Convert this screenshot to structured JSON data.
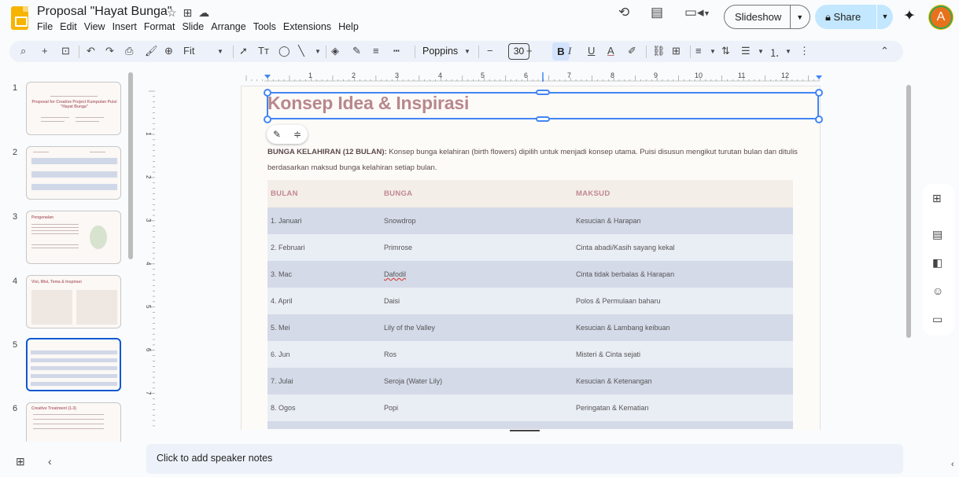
{
  "doc": {
    "title": "Proposal \"Hayat Bunga\""
  },
  "menu": [
    "File",
    "Edit",
    "View",
    "Insert",
    "Format",
    "Slide",
    "Arrange",
    "Tools",
    "Extensions",
    "Help"
  ],
  "header": {
    "slideshow_label": "Slideshow",
    "share_label": "Share",
    "avatar_letter": "A"
  },
  "toolbar": {
    "zoom_label": "Fit",
    "font_name": "Poppins",
    "font_size": "30",
    "bold": "B",
    "italic": "I",
    "underline": "U",
    "text_color": "A"
  },
  "filmstrip": {
    "slides": [
      {
        "number": "1",
        "title": "Proposal for Creative Project Kumpulan Puisi \"Hayat Bunga\""
      },
      {
        "number": "2"
      },
      {
        "number": "3",
        "title": "Pengenalan"
      },
      {
        "number": "4",
        "title": "Visi, Misi, Tema & Inspirasi"
      },
      {
        "number": "5"
      },
      {
        "number": "6",
        "title": "Creative Treatment (1-3)"
      }
    ]
  },
  "slide": {
    "title": "Konsep Idea & Inspirasi",
    "body_bold": "BUNGA KELAHIRAN (12 BULAN):",
    "body_text": " Konsep bunga kelahiran (birth flowers) dipilih untuk menjadi konsep utama. Puisi disusun mengikut turutan bulan dan ditulis berdasarkan maksud bunga kelahiran setiap bulan.",
    "table": {
      "headers": [
        "BULAN",
        "BUNGA",
        "MAKSUD"
      ],
      "rows": [
        [
          "1. Januari",
          "Snowdrop",
          "Kesucian & Harapan"
        ],
        [
          "2. Februari",
          "Primrose",
          "Cinta abadi/Kasih sayang kekal"
        ],
        [
          "3. Mac",
          "Dafodil",
          "Cinta tidak berbalas & Harapan"
        ],
        [
          "4. April",
          "Daisi",
          "Polos & Permulaan baharu"
        ],
        [
          "5. Mei",
          "Lily of the Valley",
          "Kesucian & Lambang keibuan"
        ],
        [
          "6. Jun",
          "Ros",
          "Misteri & Cinta sejati"
        ],
        [
          "7. Julai",
          "Seroja (Water Lily)",
          "Kesucian & Ketenangan"
        ],
        [
          "8. Ogos",
          "Popi",
          "Peringatan & Kematian"
        ]
      ]
    }
  },
  "ruler": {
    "top": [
      "1",
      "2",
      "3",
      "4",
      "5",
      "6",
      "7",
      "8",
      "9",
      "10",
      "11",
      "12"
    ],
    "left": [
      "1",
      "2",
      "3",
      "4",
      "5",
      "6",
      "7"
    ]
  },
  "notes": {
    "placeholder": "Click to add speaker notes"
  },
  "colors": {
    "accent": "#0b57d0",
    "share_bg": "#c2e7ff",
    "title_rose": "#b8878c",
    "table_dark": "#d4dae8",
    "table_light": "#e9edf4"
  }
}
